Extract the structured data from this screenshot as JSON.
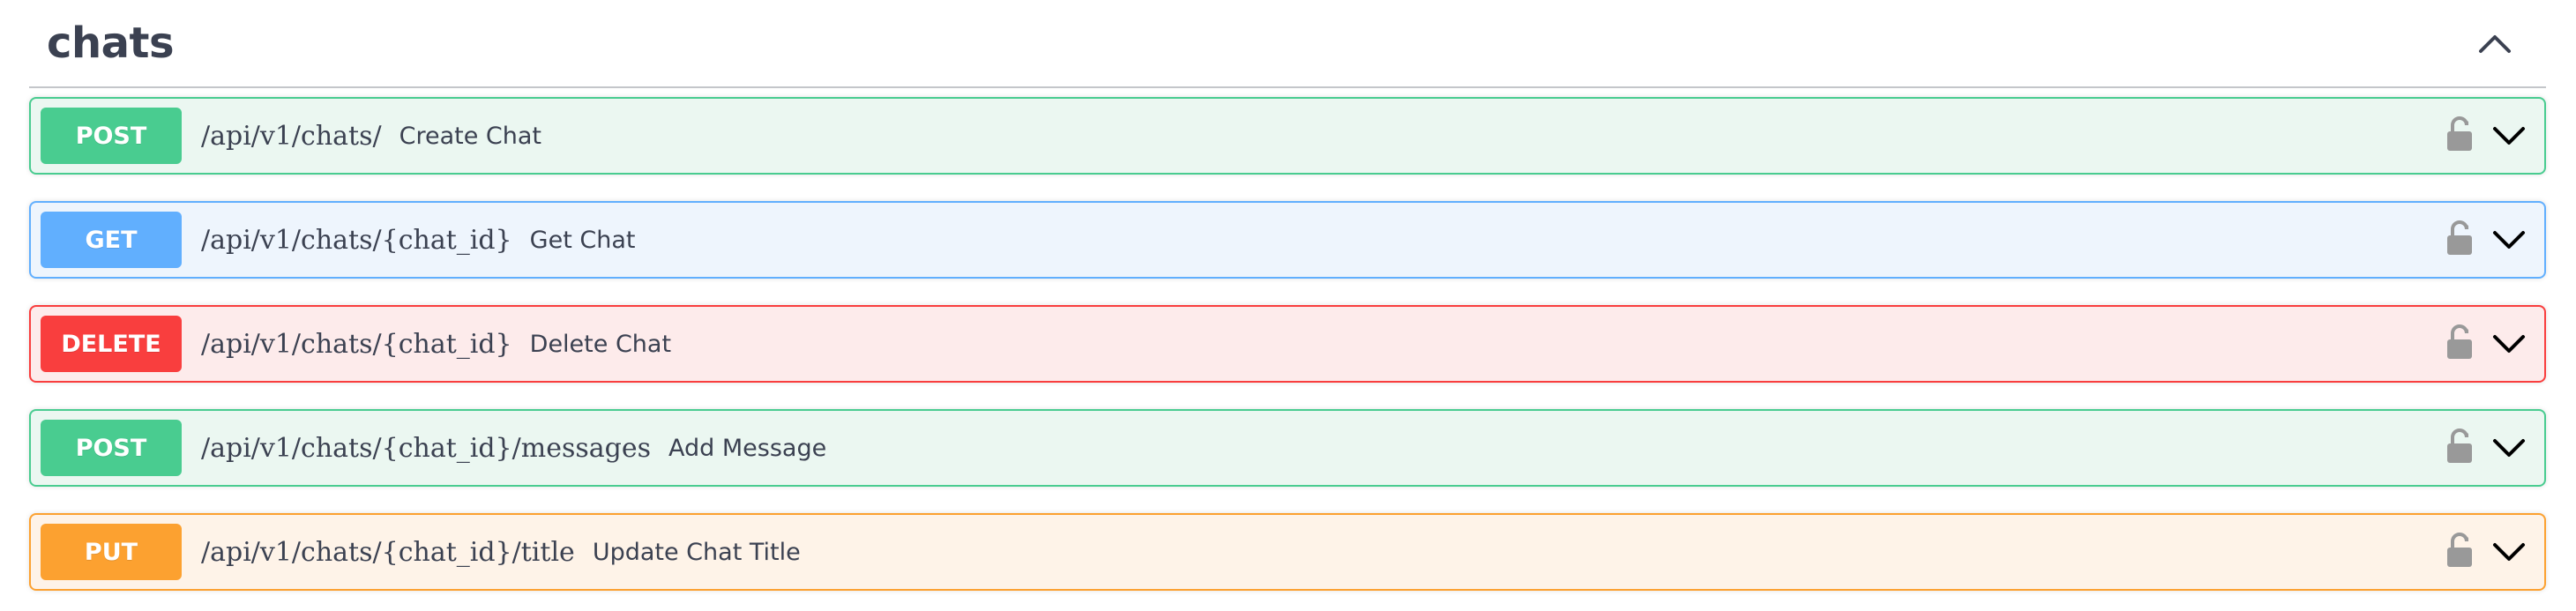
{
  "section": {
    "title": "chats",
    "collapse_icon": "chevron-up-icon"
  },
  "operations": [
    {
      "method": "POST",
      "path": "/api/v1/chats/",
      "summary": "Create Chat",
      "color": "#49cc90",
      "bg": "#ebf7f1"
    },
    {
      "method": "GET",
      "path": "/api/v1/chats/{chat_id}",
      "summary": "Get Chat",
      "color": "#61affe",
      "bg": "#eef5fd"
    },
    {
      "method": "DELETE",
      "path": "/api/v1/chats/{chat_id}",
      "summary": "Delete Chat",
      "color": "#f93e3e",
      "bg": "#fdebeb"
    },
    {
      "method": "POST",
      "path": "/api/v1/chats/{chat_id}/messages",
      "summary": "Add Message",
      "color": "#49cc90",
      "bg": "#ebf7f1"
    },
    {
      "method": "PUT",
      "path": "/api/v1/chats/{chat_id}/title",
      "summary": "Update Chat Title",
      "color": "#fca130",
      "bg": "#fef3e8"
    }
  ],
  "icons": {
    "lock": "unlocked-lock-icon",
    "expand": "chevron-down-icon"
  }
}
